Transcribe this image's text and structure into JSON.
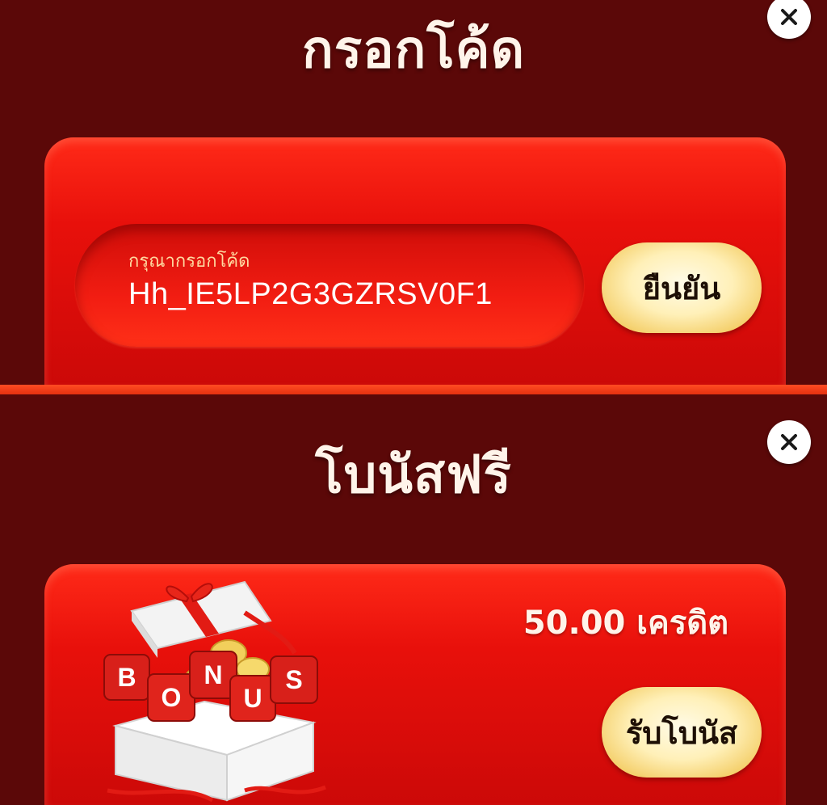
{
  "code_section": {
    "title": "กรอกโค้ด",
    "input_label": "กรุณากรอกโค้ด",
    "input_value": "Hh_IE5LP2G3GZRSV0F1",
    "confirm_label": "ยืนยัน",
    "close_icon": "close-icon"
  },
  "bonus_section": {
    "title": "โบนัสฟรี",
    "credit_text": "50.00 เครดิต",
    "claim_label": "รับโบนัส",
    "close_icon": "close-icon",
    "dice_letters": [
      "B",
      "O",
      "N",
      "U",
      "S"
    ]
  },
  "colors": {
    "background": "#5b0808",
    "panel": "#e8100b",
    "button_gold": "#f4cf6a",
    "title_text": "#fff4ea"
  }
}
